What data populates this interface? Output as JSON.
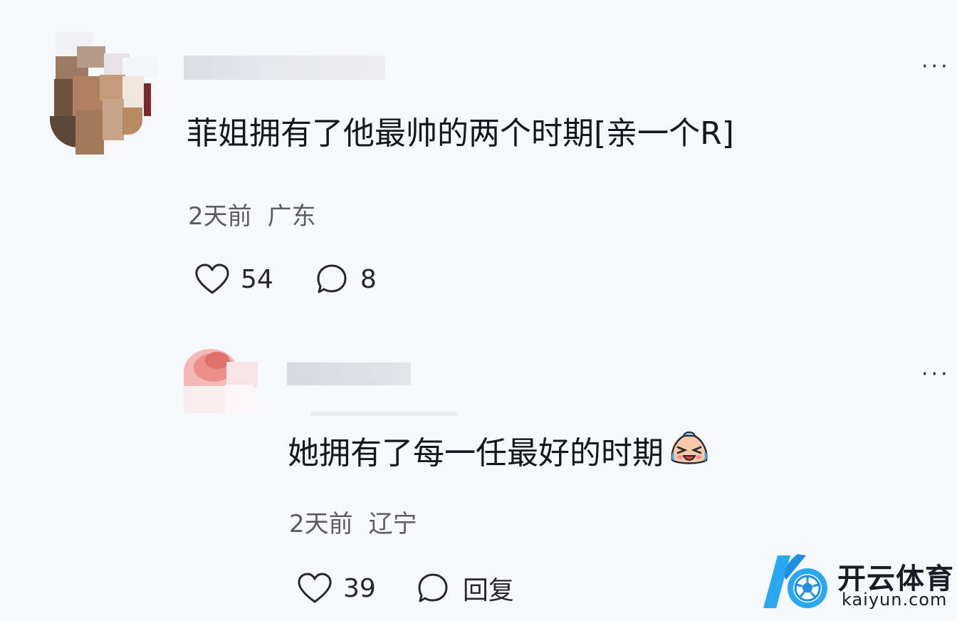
{
  "comments": [
    {
      "text": "菲姐拥有了他最帅的两个时期[亲一个R]",
      "time": "2天前",
      "location": "广东",
      "likes": "54",
      "replies": "8",
      "more_icon": "ellipsis-icon"
    },
    {
      "text": "她拥有了每一任最好的时期",
      "emoji": "crying-laughing-emoji",
      "time": "2天前",
      "location": "辽宁",
      "likes": "39",
      "reply_label": "回复",
      "more_icon": "ellipsis-icon"
    }
  ],
  "watermark": {
    "brand": "开云体育",
    "domain": "kaiyun.com"
  },
  "colors": {
    "background": "#f7f8fc",
    "text": "#16161f",
    "meta": "#5d5b66",
    "watermark_blue": "#2aa8ef"
  }
}
